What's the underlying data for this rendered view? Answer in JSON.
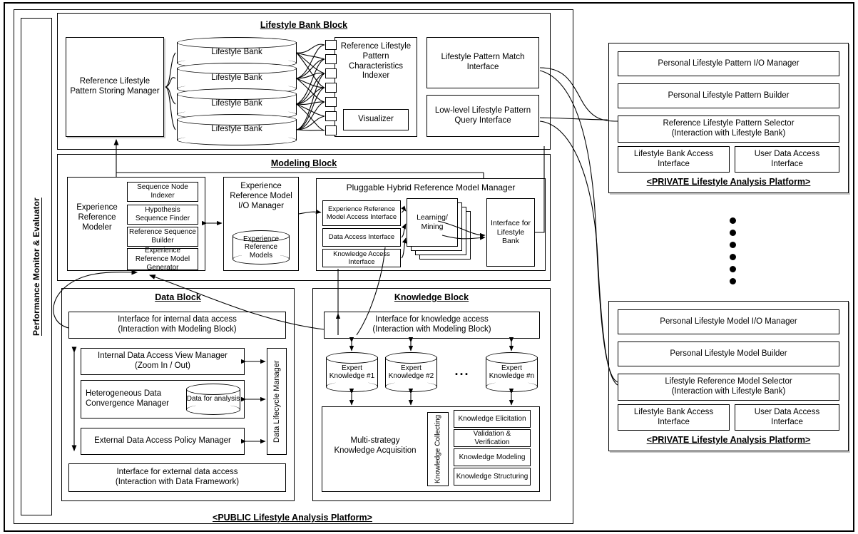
{
  "diagram": {
    "public_platform_caption": "<PUBLIC Lifestyle Analysis Platform>",
    "side_label": "Performance Monitor & Evaluator"
  },
  "lifestyle_bank_block": {
    "title": "Lifestyle Bank Block",
    "storing_manager": "Reference Lifestyle Pattern Storing Manager",
    "banks": [
      "Lifestyle Bank",
      "Lifestyle Bank",
      "Lifestyle Bank",
      "Lifestyle Bank"
    ],
    "indexer": "Reference Lifestyle Pattern Characteristics Indexer",
    "visualizer": "Visualizer",
    "match_interface": "Lifestyle Pattern Match Interface",
    "query_interface": "Low-level Lifestyle Pattern Query Interface",
    "port_count": 7
  },
  "modeling_block": {
    "title": "Modeling Block",
    "experience_reference_modeler": "Experience Reference Modeler",
    "modeler_items": [
      "Sequence Node Indexer",
      "Hypothesis Sequence Finder",
      "Reference Sequence Builder",
      "Experience Reference Model Generator"
    ],
    "io_manager": "Experience Reference Model I/O Manager",
    "io_store": "Experience Reference Models",
    "phrm_title": "Pluggable Hybrid Reference Model Manager",
    "phrm_interfaces": [
      "Experience Reference Model Access Interface",
      "Data Access Interface",
      "Knowledge Access Interface"
    ],
    "learning_mining": "Learning/ Mining",
    "interface_for_lifestyle_bank": "Interface for Lifestyle Bank"
  },
  "data_block": {
    "title": "Data Block",
    "internal_interface": "Interface for internal data access (Interaction with Modeling Block)",
    "internal_interface_l1": "Interface for internal data access",
    "internal_interface_l2": "(Interaction with Modeling Block)",
    "view_manager_l1": "Internal Data Access View Manager",
    "view_manager_l2": "(Zoom In / Out)",
    "convergence_manager": "Heterogeneous Data Convergence Manager",
    "data_for_analysis": "Data for analysis",
    "policy_manager": "External Data Access Policy Manager",
    "lifecycle_manager": "Data Lifecycle Manager",
    "external_interface_l1": "Interface for external data access",
    "external_interface_l2": "(Interaction with Data Framework)"
  },
  "knowledge_block": {
    "title": "Knowledge Block",
    "knowledge_interface_l1": "Interface for knowledge access",
    "knowledge_interface_l2": "(Interaction with Modeling Block)",
    "expert_stores": [
      "Expert Knowledge #1",
      "Expert Knowledge #2",
      "Expert Knowledge #n"
    ],
    "ellipsis": "...",
    "acquisition_l1": "Multi-strategy",
    "acquisition_l2": "Knowledge Acquisition",
    "collecting": "Knowledge Collecting",
    "steps": [
      "Knowledge Elicitation",
      "Validation & Verification",
      "Knowledge Modeling",
      "Knowledge Structuring"
    ]
  },
  "private_platforms": [
    {
      "caption": "<PRIVATE Lifestyle Analysis Platform>",
      "rows": [
        "Personal Lifestyle Pattern I/O Manager",
        "Personal Lifestyle Pattern Builder",
        "Reference Lifestyle Pattern Selector (Interaction with Lifestyle Bank)"
      ],
      "selector_l1": "Reference Lifestyle Pattern Selector",
      "selector_l2": "(Interaction with Lifestyle Bank)",
      "bottom_left_l1": "Lifestyle Bank Access",
      "bottom_left_l2": "Interface",
      "bottom_right_l1": "User Data Access",
      "bottom_right_l2": "Interface"
    },
    {
      "caption": "<PRIVATE Lifestyle Analysis Platform>",
      "rows": [
        "Personal Lifestyle Model I/O Manager",
        "Personal Lifestyle Model Builder",
        "Lifestyle Reference Model Selector (Interaction with Lifestyle Bank)"
      ],
      "selector_l1": "Lifestyle Reference Model Selector",
      "selector_l2": "(Interaction with Lifestyle Bank)",
      "bottom_left_l1": "Lifestyle Bank Access",
      "bottom_left_l2": "Interface",
      "bottom_right_l1": "User Data Access",
      "bottom_right_l2": "Interface"
    }
  ],
  "colors": {
    "stroke": "#000000",
    "background": "#ffffff"
  }
}
